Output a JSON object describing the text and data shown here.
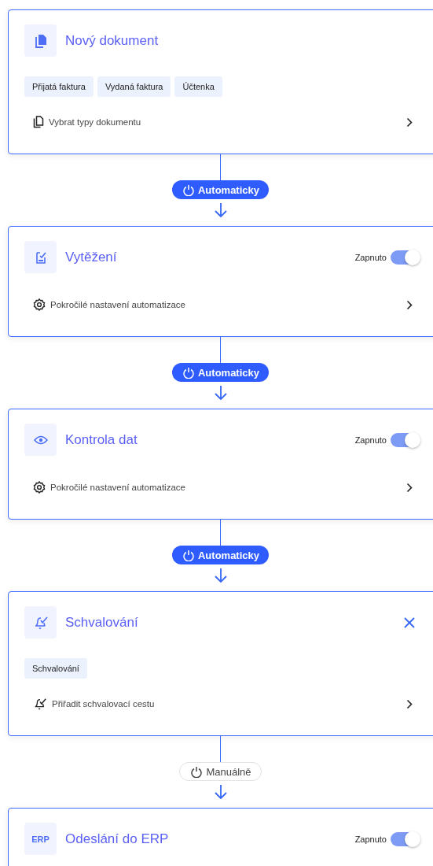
{
  "steps": [
    {
      "kind": "document",
      "title": "Nový dokument",
      "tags": [
        "Přijatá faktura",
        "Vydaná faktura",
        "Účtenka"
      ],
      "action": {
        "kind": "document",
        "label": "Vybrat typy dokumentu"
      }
    },
    {
      "kind": "extract",
      "trigger": {
        "label": "Automaticky",
        "automatic": true
      },
      "title": "Vytěžení",
      "toggle": {
        "label": "Zapnuto",
        "on": true
      },
      "action": {
        "kind": "gear",
        "label": "Pokročilé nastavení automatizace"
      }
    },
    {
      "kind": "eye",
      "trigger": {
        "label": "Automaticky",
        "automatic": true
      },
      "title": "Kontrola dat",
      "toggle": {
        "label": "Zapnuto",
        "on": true
      },
      "action": {
        "kind": "gear",
        "label": "Pokročilé nastavení automatizace"
      }
    },
    {
      "kind": "bell",
      "trigger": {
        "label": "Automaticky",
        "automatic": true
      },
      "title": "Schvalování",
      "closable": true,
      "tags": [
        "Schvalování"
      ],
      "action": {
        "kind": "bell",
        "label": "Přiřadit schvalovací cestu"
      }
    },
    {
      "kind": "erp",
      "trigger": {
        "label": "Manuálně",
        "automatic": false
      },
      "icon_label": "ERP",
      "title": "Odeslání do ERP",
      "toggle": {
        "label": "Zapnuto",
        "on": true
      }
    }
  ]
}
